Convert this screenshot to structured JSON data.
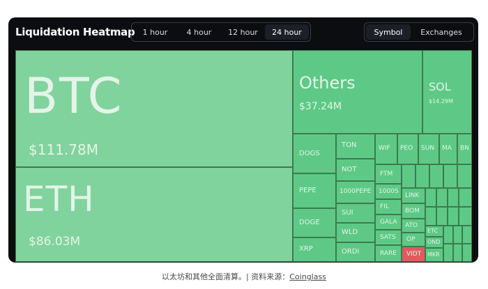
{
  "header": {
    "title": "Liquidation Heatmap",
    "time_options": [
      "1 hour",
      "4 hour",
      "12 hour",
      "24 hour"
    ],
    "time_selected": "24 hour",
    "view_options": [
      "Symbol",
      "Exchanges"
    ],
    "view_selected": "Symbol"
  },
  "tiles": {
    "btc": {
      "symbol": "BTC",
      "value": "$111.78M"
    },
    "eth": {
      "symbol": "ETH",
      "value": "$86.03M"
    },
    "others": {
      "symbol": "Others",
      "value": "$37.24M"
    },
    "sol": {
      "symbol": "SOL",
      "value": "$14.29M"
    },
    "dogs": {
      "symbol": "DOGS"
    },
    "ton": {
      "symbol": "TON"
    },
    "wif": {
      "symbol": "WIF"
    },
    "peo": {
      "symbol": "PEO"
    },
    "sun": {
      "symbol": "SUN"
    },
    "mat": {
      "symbol": "MA"
    },
    "bnb": {
      "symbol": "BN"
    },
    "not": {
      "symbol": "NOT"
    },
    "pepe": {
      "symbol": "PEPE"
    },
    "pepe1000": {
      "symbol": "1000PEPE"
    },
    "ftm": {
      "symbol": "FTM"
    },
    "link": {
      "symbol": "LINK"
    },
    "sats1000": {
      "symbol": "1000S"
    },
    "fil": {
      "symbol": "FIL"
    },
    "sui": {
      "symbol": "SUI"
    },
    "doge": {
      "symbol": "DOGE"
    },
    "bom": {
      "symbol": "BOM"
    },
    "gala": {
      "symbol": "GALA"
    },
    "wld": {
      "symbol": "WLD"
    },
    "ato": {
      "symbol": "ATO"
    },
    "xrp": {
      "symbol": "XRP"
    },
    "ordi": {
      "symbol": "ORDI"
    },
    "sats": {
      "symbol": "SATS"
    },
    "op": {
      "symbol": "OP"
    },
    "rare": {
      "symbol": "RARE"
    },
    "vidt": {
      "symbol": "VIDT"
    },
    "etc": {
      "symbol": "ETC"
    },
    "ond": {
      "symbol": "OND"
    },
    "mkr": {
      "symbol": "MKR"
    }
  },
  "colors": {
    "tile_light": "#80d39c",
    "tile_mid": "#5ec986",
    "tile_dark": "#4fbc77",
    "tile_red": "#e05a5e",
    "card_bg": "#0b0d10"
  },
  "caption": {
    "text": "以太坊和其他全面清算。| 资料来源：",
    "link": "Coinglass"
  }
}
